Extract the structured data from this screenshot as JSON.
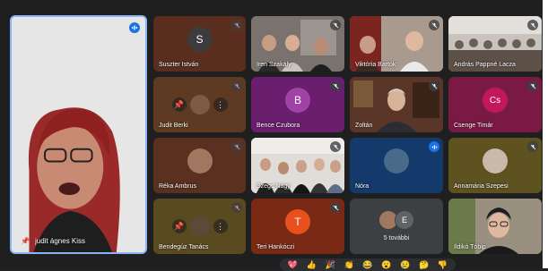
{
  "colors": {
    "bg": "#1f1f1f",
    "accent": "#1a73e8"
  },
  "main_speaker": {
    "name": "judit ágnes Kiss",
    "pin_icon": "pin-icon",
    "speaking_icon": "audio-level-icon"
  },
  "tiles": {
    "t1": {
      "name": "Suszter István",
      "initial": "S",
      "muted": true
    },
    "t2": {
      "name": "Iren Szakály",
      "muted": true
    },
    "t3": {
      "name": "Viktória Bartók",
      "muted": true
    },
    "t4": {
      "name": "András Pappné Lacza",
      "muted": true
    },
    "t5": {
      "name": "Judit Berki",
      "muted": true
    },
    "t6": {
      "name": "Bence Czubora",
      "initial": "B",
      "muted": true
    },
    "t7": {
      "name": "Zoltán",
      "muted": true
    },
    "t8": {
      "name": "Csenge Timár",
      "initial": "Cs",
      "muted": true
    },
    "t9": {
      "name": "Réka Ambrus",
      "muted": true
    },
    "t10": {
      "name": "Szegs Nagy",
      "muted": true
    },
    "t11": {
      "name": "Nóra",
      "muted": false
    },
    "t12": {
      "name": "Annamária Szepesi",
      "muted": true
    },
    "t13": {
      "name": "Bendegúz Tanács",
      "muted": true
    },
    "t14": {
      "name": "Teri Hankóczi",
      "initial": "T",
      "muted": true
    },
    "t15": {
      "more_label": "5 további",
      "initial": "E"
    },
    "t16": {
      "name": "Ildikó Tóbip"
    }
  },
  "reactions": [
    "💖",
    "👍",
    "🎉",
    "👏",
    "😂",
    "😮",
    "😢",
    "🤔",
    "👎"
  ]
}
